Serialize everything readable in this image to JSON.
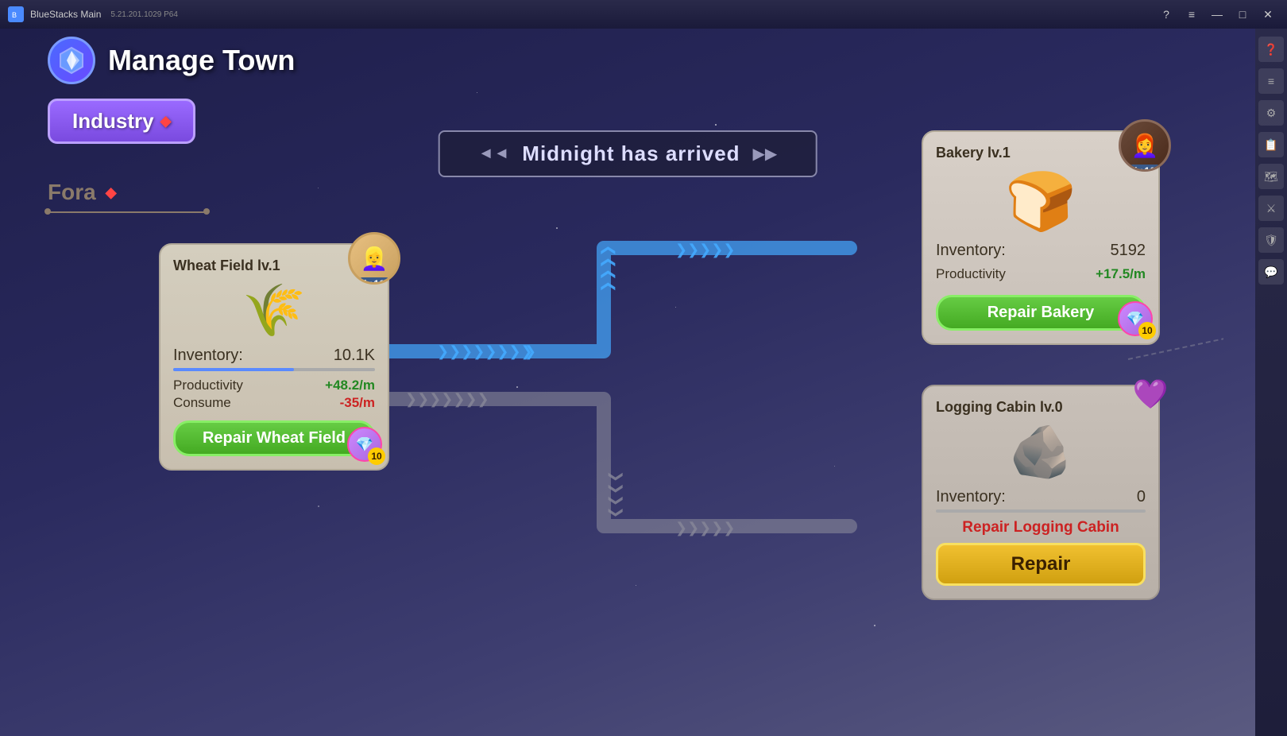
{
  "titlebar": {
    "app_name": "BlueStacks Main",
    "version": "5.21.201.1029 P64",
    "controls": [
      "?",
      "≡",
      "—",
      "□",
      "✕"
    ]
  },
  "page": {
    "icon": "🔙",
    "title": "Manage Town"
  },
  "industry_button": {
    "label": "Industry",
    "diamond": "◆"
  },
  "character": {
    "name": "Fora",
    "diamond": "◆"
  },
  "midnight_banner": {
    "text": "Midnight has arrived",
    "left_arrow": "◄◄",
    "right_arrow": "▶▶"
  },
  "wheat_card": {
    "title": "Wheat Field lv.1",
    "avatar_level": "lv.16",
    "inventory_label": "Inventory:",
    "inventory_value": "10.1K",
    "productivity_label": "Productivity",
    "productivity_value": "+48.2/m",
    "consume_label": "Consume",
    "consume_value": "-35/m",
    "repair_label": "Repair Wheat Field",
    "repair_cost": "10"
  },
  "bakery_card": {
    "title": "Bakery lv.1",
    "avatar_level": "lv.16",
    "inventory_label": "Inventory:",
    "inventory_value": "5192",
    "productivity_label": "Productivity",
    "productivity_value": "+17.5/m",
    "repair_label": "Repair Bakery",
    "repair_cost": "10"
  },
  "logging_card": {
    "title": "Logging Cabin lv.0",
    "inventory_label": "Inventory:",
    "inventory_value": "0",
    "repair_text": "Repair Logging Cabin",
    "repair_button": "Repair"
  },
  "sidebar_icons": [
    "?",
    "≡",
    "⚙",
    "📋",
    "🗺",
    "⚔",
    "🛡",
    "💬"
  ]
}
